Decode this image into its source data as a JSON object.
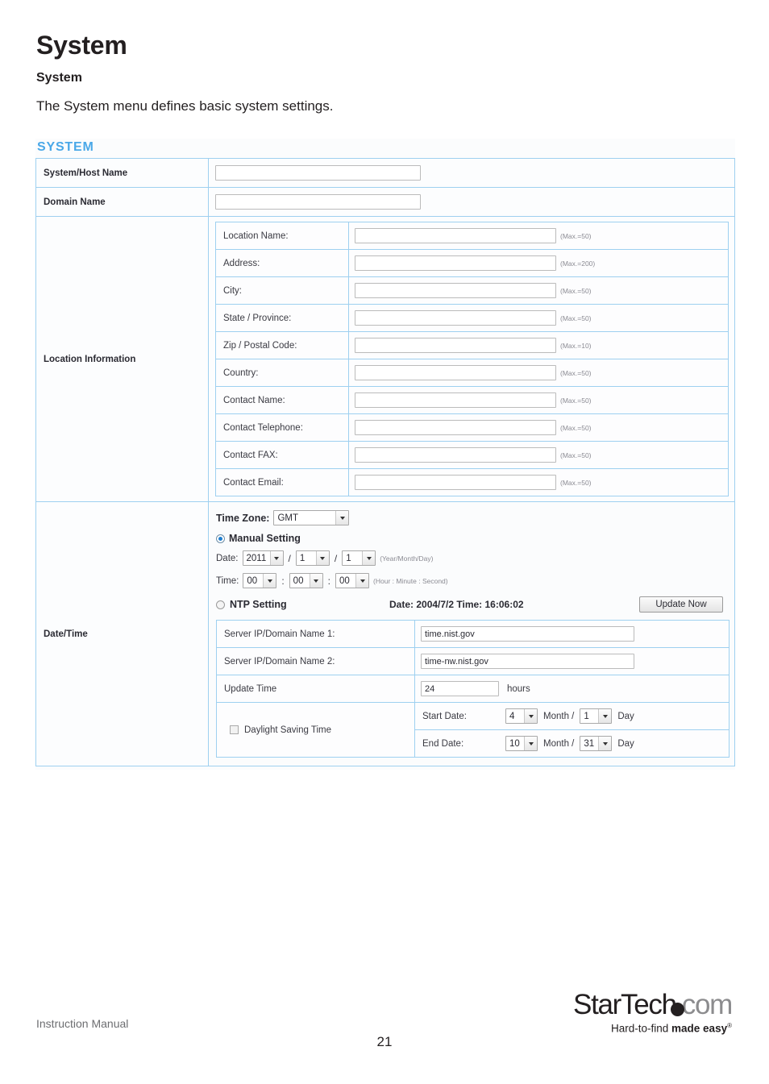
{
  "document": {
    "title": "System",
    "subtitle": "System",
    "paragraph": "The System menu defines basic system settings."
  },
  "screenshot": {
    "panel_title": "SYSTEM",
    "accent_color": "#4aa8e8",
    "border_color": "#9ed0f0",
    "top_fields": [
      {
        "label": "System/Host Name",
        "value": ""
      },
      {
        "label": "Domain Name",
        "value": ""
      }
    ],
    "location_information": {
      "label": "Location Information",
      "rows": [
        {
          "label": "Location Name:",
          "value": "",
          "max": "(Max.=50)"
        },
        {
          "label": "Address:",
          "value": "",
          "max": "(Max.=200)"
        },
        {
          "label": "City:",
          "value": "",
          "max": "(Max.=50)"
        },
        {
          "label": "State / Province:",
          "value": "",
          "max": "(Max.=50)"
        },
        {
          "label": "Zip / Postal Code:",
          "value": "",
          "max": "(Max.=10)"
        },
        {
          "label": "Country:",
          "value": "",
          "max": "(Max.=50)"
        },
        {
          "label": "Contact Name:",
          "value": "",
          "max": "(Max.=50)"
        },
        {
          "label": "Contact Telephone:",
          "value": "",
          "max": "(Max.=50)"
        },
        {
          "label": "Contact FAX:",
          "value": "",
          "max": "(Max.=50)"
        },
        {
          "label": "Contact Email:",
          "value": "",
          "max": "(Max.=50)"
        }
      ]
    },
    "date_time": {
      "label": "Date/Time",
      "time_zone": {
        "label": "Time Zone:",
        "value": "GMT"
      },
      "manual_setting": {
        "label": "Manual Setting",
        "selected": true,
        "date_label": "Date:",
        "year": "2011",
        "month": "1",
        "day": "1",
        "date_hint": "(Year/Month/Day)",
        "time_label": "Time:",
        "hour": "00",
        "minute": "00",
        "second": "00",
        "time_hint": "(Hour : Minute : Second)",
        "date_sep": "/",
        "time_sep": ":"
      },
      "ntp_setting": {
        "label": "NTP Setting",
        "selected": false,
        "status": "Date: 2004/7/2 Time: 16:06:02",
        "update_button": "Update Now"
      },
      "ntp_rows": [
        {
          "label": "Server IP/Domain Name 1:",
          "value": "time.nist.gov"
        },
        {
          "label": "Server IP/Domain Name 2:",
          "value": "time-nw.nist.gov"
        },
        {
          "label": "Update Time",
          "value": "24",
          "suffix": "hours"
        }
      ],
      "daylight_saving": {
        "label": "Daylight Saving Time",
        "checked": false,
        "start": {
          "label": "Start Date:",
          "month": "4",
          "month_word": "Month /",
          "day": "1",
          "day_word": "Day"
        },
        "end": {
          "label": "End Date:",
          "month": "10",
          "month_word": "Month /",
          "day": "31",
          "day_word": "Day"
        }
      }
    }
  },
  "footer": {
    "manual_label": "Instruction Manual",
    "page_number": "21",
    "logo": {
      "name_part1": "StarTech",
      "name_part2": "com",
      "tagline_light": "Hard-to-find ",
      "tagline_bold": "made easy",
      "tagline_mark": "®"
    }
  }
}
